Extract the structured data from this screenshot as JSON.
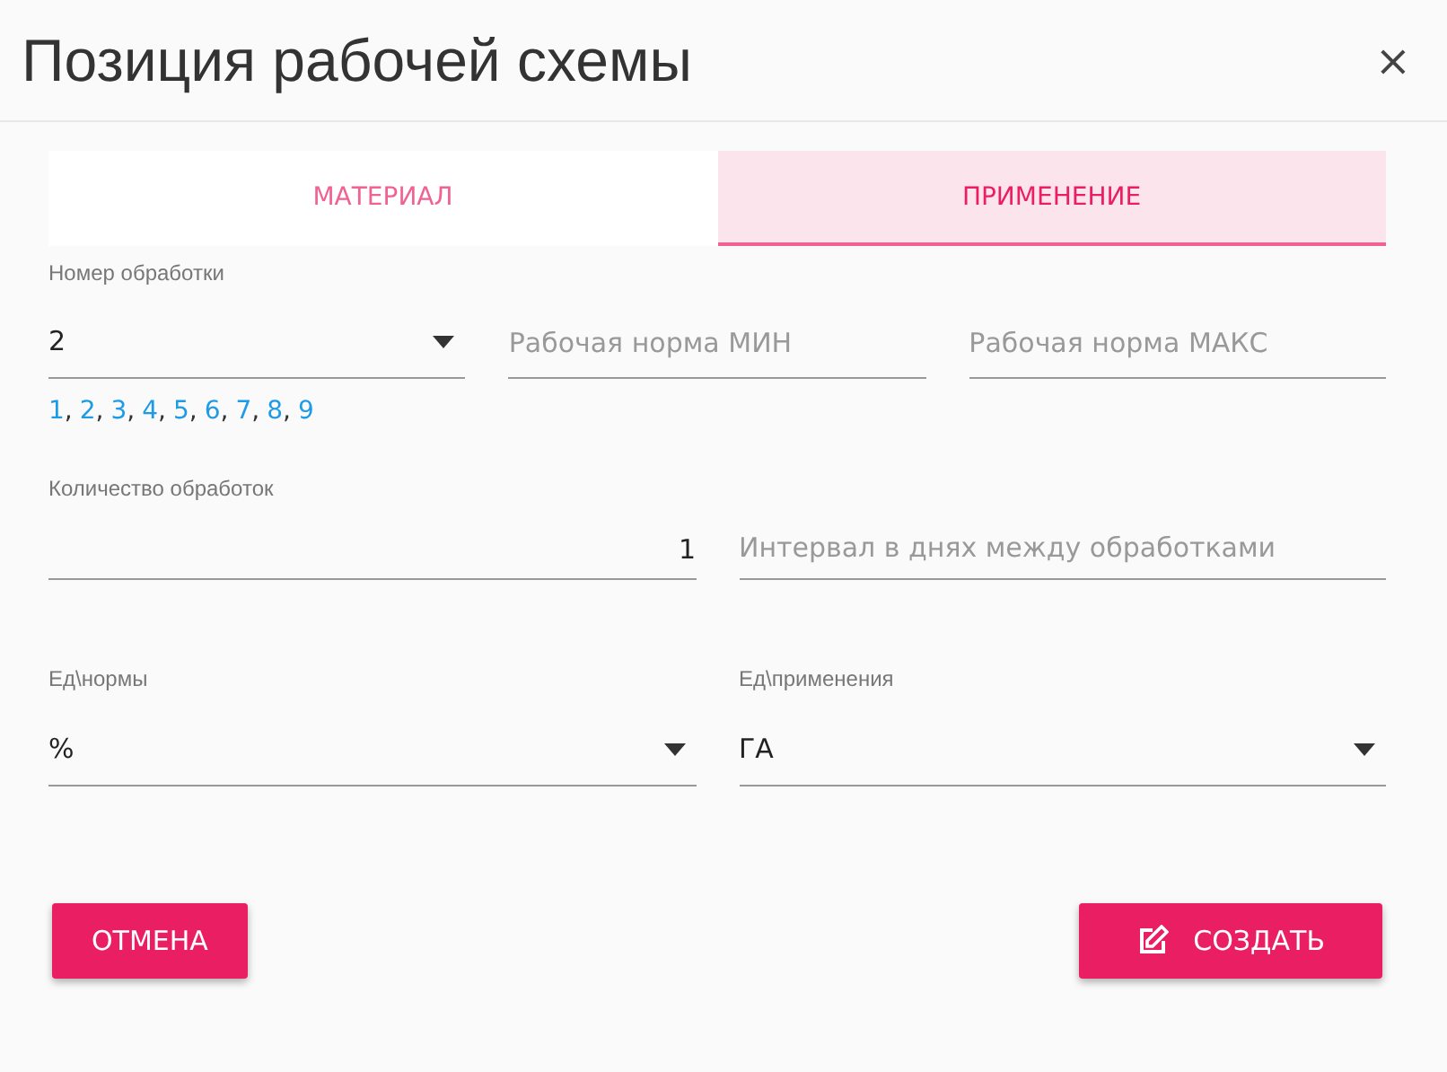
{
  "dialog": {
    "title": "Позиция рабочей схемы",
    "close": "×"
  },
  "tabs": [
    {
      "label": "МАТЕРИАЛ",
      "selected": false
    },
    {
      "label": "ПРИМЕНЕНИЕ",
      "selected": true
    }
  ],
  "rows": [
    {
      "fields": [
        {
          "kind": "select",
          "label": "Номер обработки",
          "value": "2",
          "links": [
            {
              "label": "1",
              "separator": ","
            },
            {
              "label": "2",
              "separator": ","
            },
            {
              "label": "3",
              "separator": ","
            },
            {
              "label": "4",
              "separator": ","
            },
            {
              "label": "5",
              "separator": ","
            },
            {
              "label": "6",
              "separator": ","
            },
            {
              "label": "7",
              "separator": ","
            },
            {
              "label": "8",
              "separator": ","
            },
            {
              "label": "9"
            }
          ]
        },
        {
          "kind": "input",
          "placeholder": "Рабочая норма МИН"
        },
        {
          "kind": "input",
          "placeholder": "Рабочая норма МАКС"
        }
      ]
    },
    {
      "fields": [
        {
          "kind": "number",
          "label": "Количество обработок",
          "value": "1"
        },
        {
          "kind": "input",
          "placeholder": "Интервал в днях между обработками"
        }
      ]
    },
    {
      "fields": [
        {
          "kind": "select",
          "label": "Ед\\нормы",
          "value": "%"
        },
        {
          "kind": "select",
          "label": "Ед\\применения",
          "value": "ГА"
        }
      ]
    }
  ],
  "buttons": [
    {
      "kind": "cancel",
      "label": "ОТМЕНА"
    },
    {
      "kind": "create",
      "label": "СОЗДАТЬ"
    }
  ]
}
